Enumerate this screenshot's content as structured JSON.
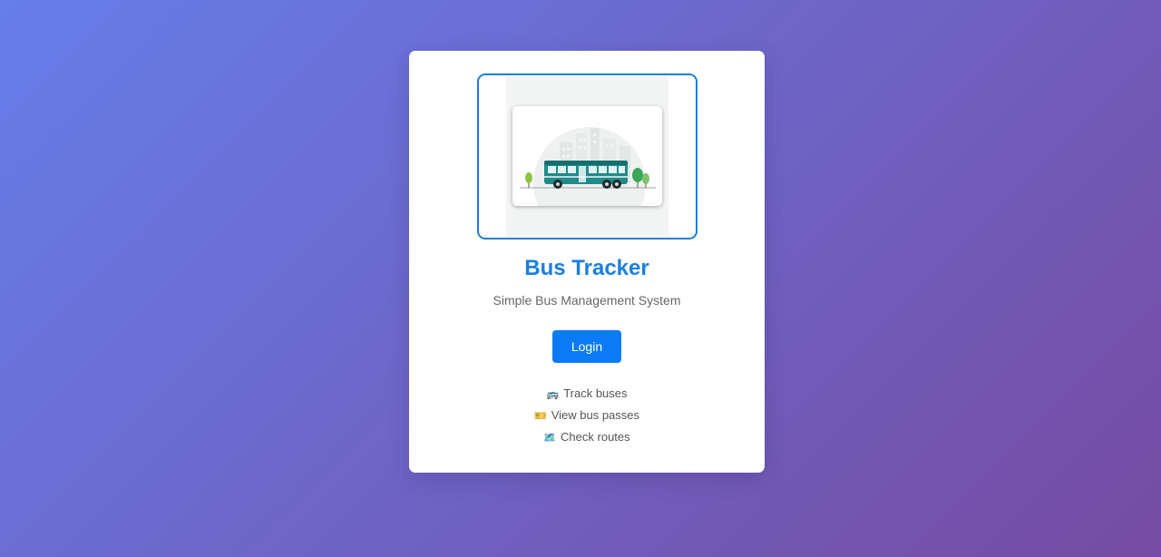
{
  "app": {
    "title": "Bus Tracker",
    "subtitle": "Simple Bus Management System"
  },
  "hero": {
    "icon": "bus-illustration"
  },
  "actions": {
    "login_label": "Login"
  },
  "features": [
    {
      "icon": "bus-emoji",
      "emoji": "🚌",
      "label": "Track buses"
    },
    {
      "icon": "ticket-emoji",
      "emoji": "🎫",
      "label": "View bus passes"
    },
    {
      "icon": "map-emoji",
      "emoji": "🗺️",
      "label": "Check routes"
    }
  ],
  "colors": {
    "background_start": "#667eea",
    "background_end": "#764ba2",
    "accent": "#1a7fe0",
    "button": "#0a7bf5"
  }
}
